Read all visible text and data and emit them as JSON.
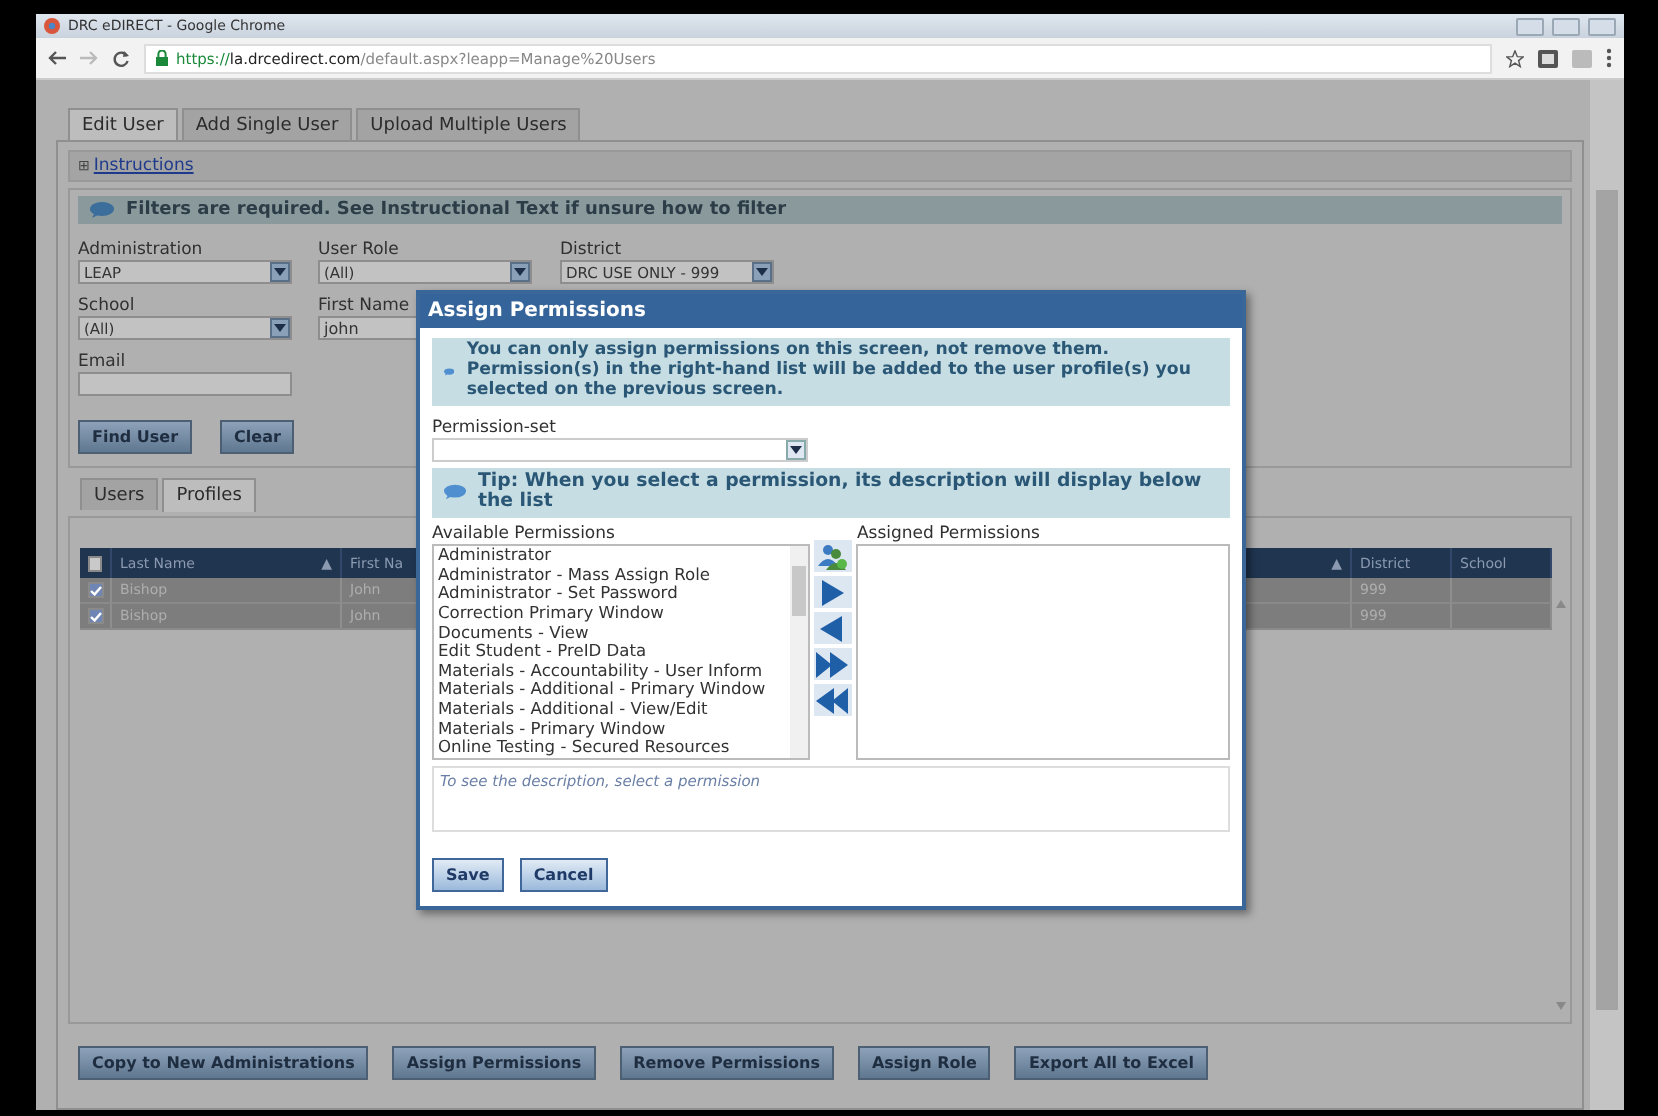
{
  "browser": {
    "title": "DRC eDIRECT - Google Chrome",
    "url": {
      "scheme": "https://",
      "host": "la.drcedirect.com",
      "path": "/default.aspx?leapp=Manage%20Users"
    }
  },
  "tabs": [
    {
      "label": "Edit User",
      "selected": true
    },
    {
      "label": "Add Single User",
      "selected": false
    },
    {
      "label": "Upload Multiple Users",
      "selected": false
    }
  ],
  "instructions": {
    "icon": "⊞",
    "label": "Instructions"
  },
  "filter_notice": "Filters are required. See Instructional Text if unsure how to filter",
  "filter_rows": [
    [
      {
        "label": "Administration",
        "kind": "select",
        "value": "LEAP"
      },
      {
        "label": "User Role",
        "kind": "select",
        "value": "(All)"
      },
      {
        "label": "District",
        "kind": "select",
        "value": "DRC USE ONLY - 999"
      }
    ],
    [
      {
        "label": "School",
        "kind": "select",
        "value": "(All)"
      },
      {
        "label": "First Name",
        "kind": "text",
        "value": "john"
      }
    ],
    [
      {
        "label": "Email",
        "kind": "text"
      }
    ]
  ],
  "filter_buttons": [
    "Find User",
    "Clear"
  ],
  "sub_tabs": [
    {
      "label": "Users",
      "selected": false
    },
    {
      "label": "Profiles",
      "selected": true
    }
  ],
  "table": {
    "select_all_checked": false,
    "columns": [
      {
        "label": "Last Name",
        "sort_mark": "▲"
      },
      {
        "label": "First Na"
      },
      {
        "sort_mark": "▲"
      },
      {
        "label": "District"
      },
      {
        "label": "School"
      }
    ],
    "rows": [
      {
        "checked": true,
        "selected": true,
        "last_name": "Bishop",
        "first_name": "John",
        "district": "999"
      },
      {
        "checked": true,
        "selected": true,
        "last_name": "Bishop",
        "first_name": "John",
        "district": "999"
      }
    ]
  },
  "action_buttons": [
    "Copy to New Administrations",
    "Assign Permissions",
    "Remove Permissions",
    "Assign Role",
    "Export All to Excel"
  ],
  "dialog": {
    "title": "Assign Permissions",
    "notice": "You can only assign permissions on this screen, not remove them. Permission(s) in the right-hand list will be added to the user profile(s) you selected on the previous screen.",
    "permission_set_label": "Permission-set",
    "tip": "Tip: When you select a permission, its description will display below the list",
    "available_label": "Available Permissions",
    "assigned_label": "Assigned Permissions",
    "available": [
      {
        "label": "Administrator",
        "selected": false
      },
      {
        "label": "Administrator - Mass Assign Role",
        "selected": false
      },
      {
        "label": "Administrator - Set Password",
        "selected": false
      },
      {
        "label": "Correction Primary Window",
        "selected": false
      },
      {
        "label": "Documents - View",
        "selected": false
      },
      {
        "label": "Edit Student - PreID Data",
        "selected": false
      },
      {
        "label": "Materials - Accountability - User Inform",
        "selected": false
      },
      {
        "label": "Materials - Additional - Primary Window",
        "selected": false
      },
      {
        "label": "Materials - Additional - View/Edit",
        "selected": false
      },
      {
        "label": "Materials - Primary Window",
        "selected": false
      },
      {
        "label": "Online Testing - Secured Resources",
        "selected": false
      }
    ],
    "move_buttons": [
      {
        "kind": "group"
      },
      {
        "kind": "right"
      },
      {
        "kind": "left"
      },
      {
        "kind": "all-right"
      },
      {
        "kind": "all-left"
      }
    ],
    "description_hint": "To see the description, select a permission",
    "buttons": [
      "Save",
      "Cancel"
    ]
  }
}
